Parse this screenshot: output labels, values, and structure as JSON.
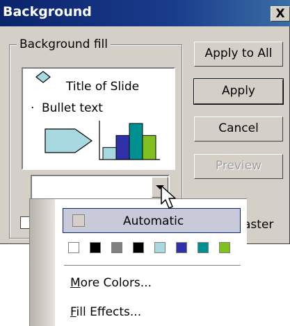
{
  "window": {
    "title": "Background",
    "close_glyph": "X"
  },
  "group": {
    "label": "Background fill"
  },
  "preview": {
    "title": "Title of Slide",
    "bullet_text": "Bullet text",
    "bullet_glyph": "·"
  },
  "buttons": {
    "apply_all": "Apply to All",
    "apply": "Apply",
    "cancel": "Cancel",
    "preview": "Preview"
  },
  "master_label": "aster",
  "menu": {
    "automatic": "Automatic",
    "more_colors": "More Colors...",
    "more_colors_key": "M",
    "more_colors_rest": "ore Colors...",
    "fill_effects": "Fill Effects...",
    "fill_effects_key": "F",
    "fill_effects_rest": "ill Effects...",
    "swatches": [
      "#ffffff",
      "#000000",
      "#808080",
      "#000000",
      "#a8d8e0",
      "#3030a8",
      "#009090",
      "#80c020"
    ]
  },
  "preview_chart": {
    "bar_colors": [
      "#a8d8e0",
      "#3030a8",
      "#009090",
      "#80c020"
    ],
    "bar_values": [
      1,
      2,
      3,
      2
    ]
  }
}
